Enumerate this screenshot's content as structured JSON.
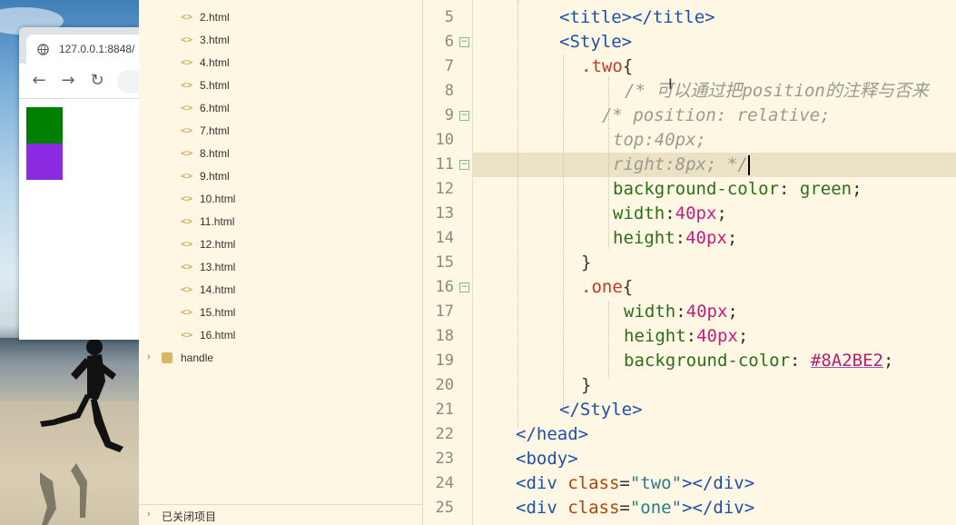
{
  "browser": {
    "url": "127.0.0.1:8848/",
    "box_two_color": "#008000",
    "box_one_color": "#8A2BE2"
  },
  "tree": {
    "files": [
      "2.html",
      "3.html",
      "4.html",
      "5.html",
      "6.html",
      "7.html",
      "8.html",
      "9.html",
      "10.html",
      "11.html",
      "12.html",
      "13.html",
      "14.html",
      "15.html",
      "16.html"
    ],
    "file_icon": "<>",
    "folder": "handle",
    "closed_projects": "已关闭项目"
  },
  "editor": {
    "line_numbers": [
      "5",
      "6",
      "7",
      "8",
      "9",
      "10",
      "11",
      "12",
      "13",
      "14",
      "15",
      "16",
      "17",
      "18",
      "19",
      "20",
      "21",
      "22",
      "23",
      "24",
      "25"
    ],
    "current_line": "11",
    "colors": {
      "tag": "#1f4fa8",
      "selector": "#c0392b",
      "property": "#2d6e1a",
      "number": "#c0207e",
      "comment": "#9a9a90"
    }
  }
}
